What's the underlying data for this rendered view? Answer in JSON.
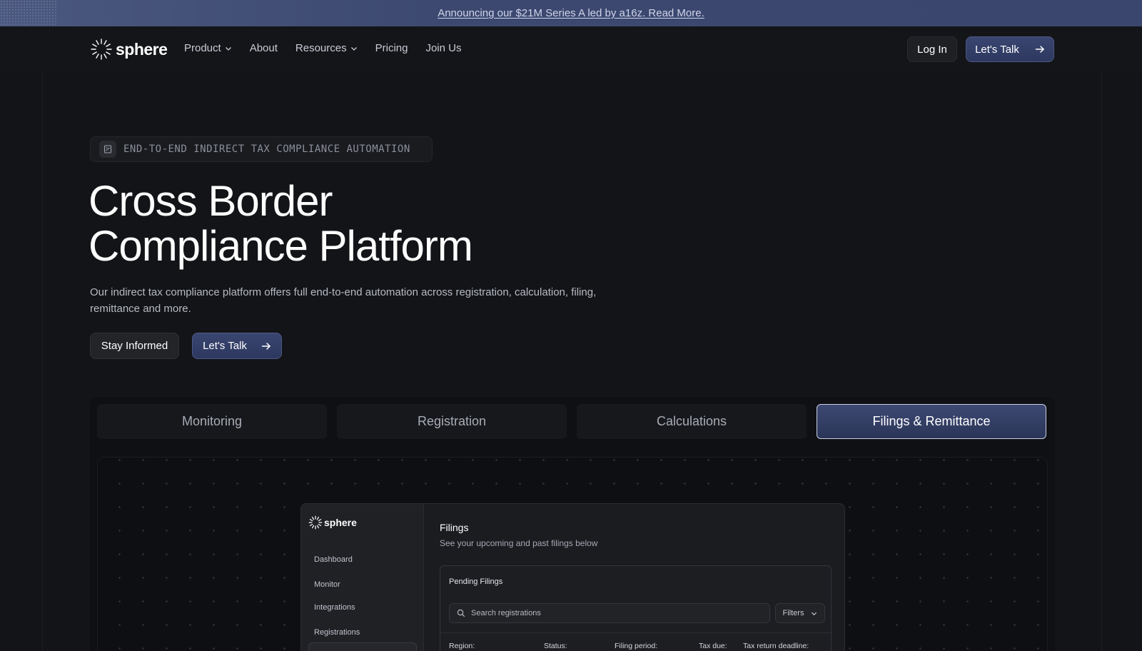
{
  "announcement": {
    "text": "Announcing our $21M Series A led by a16z. Read More."
  },
  "nav": {
    "brand": "sphere",
    "items": [
      {
        "label": "Product",
        "has_dropdown": true
      },
      {
        "label": "About",
        "has_dropdown": false
      },
      {
        "label": "Resources",
        "has_dropdown": true
      },
      {
        "label": "Pricing",
        "has_dropdown": false
      },
      {
        "label": "Join Us",
        "has_dropdown": false
      }
    ],
    "login_label": "Log In",
    "cta_label": "Let's Talk"
  },
  "hero": {
    "eyebrow": "END-TO-END INDIRECT TAX COMPLIANCE AUTOMATION",
    "title_line1": "Cross Border",
    "title_line2": "Compliance Platform",
    "description": "Our indirect tax compliance platform offers full end-to-end automation across registration, calculation, filing, remittance and more.",
    "secondary_cta": "Stay Informed",
    "primary_cta": "Let's Talk"
  },
  "tabs": [
    {
      "label": "Monitoring",
      "active": false
    },
    {
      "label": "Registration",
      "active": false
    },
    {
      "label": "Calculations",
      "active": false
    },
    {
      "label": "Filings & Remittance",
      "active": true
    }
  ],
  "app_preview": {
    "brand": "sphere",
    "sidebar": [
      "Dashboard",
      "Monitor",
      "Integrations",
      "Registrations"
    ],
    "title": "Filings",
    "subtitle": "See your upcoming and past filings below",
    "card_title": "Pending Filings",
    "search_placeholder": "Search registrations",
    "filters_label": "Filters",
    "columns": [
      "Region:",
      "Status:",
      "Filing period:",
      "Tax due:",
      "Tax return deadline:"
    ]
  },
  "colors": {
    "background": "#131417",
    "accent": "#3a4670",
    "announcement_bg": "#3c4870"
  }
}
